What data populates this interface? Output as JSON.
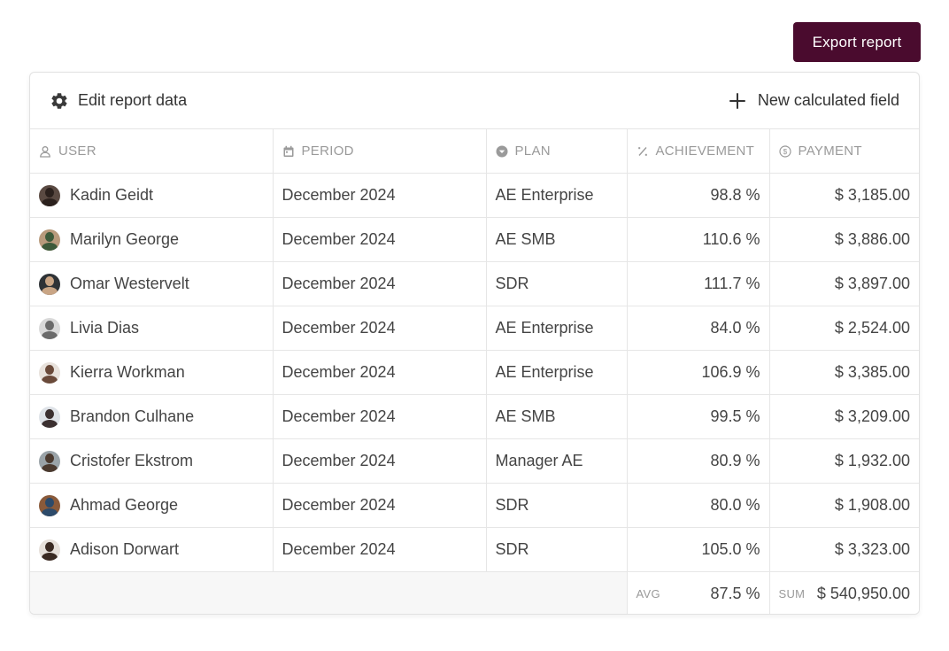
{
  "toolbar": {
    "export_label": "Export report",
    "edit_label": "Edit report data",
    "new_field_label": "New calculated field"
  },
  "columns": {
    "user": "USER",
    "period": "PERIOD",
    "plan": "PLAN",
    "achievement": "ACHIEVEMENT",
    "payment": "PAYMENT"
  },
  "rows": [
    {
      "name": "Kadin Geidt",
      "period": "December 2024",
      "plan": "AE Enterprise",
      "achievement": "98.8 %",
      "payment": "$ 3,185.00",
      "avatar_bg": "#5a4a42",
      "avatar_fg": "#2b211d"
    },
    {
      "name": "Marilyn George",
      "period": "December 2024",
      "plan": "AE SMB",
      "achievement": "110.6 %",
      "payment": "$ 3,886.00",
      "avatar_bg": "#b89a7c",
      "avatar_fg": "#3d5a3a"
    },
    {
      "name": "Omar Westervelt",
      "period": "December 2024",
      "plan": "SDR",
      "achievement": "111.7 %",
      "payment": "$ 3,897.00",
      "avatar_bg": "#2e3236",
      "avatar_fg": "#c9a585"
    },
    {
      "name": "Livia Dias",
      "period": "December 2024",
      "plan": "AE Enterprise",
      "achievement": "84.0 %",
      "payment": "$ 2,524.00",
      "avatar_bg": "#d9d9d9",
      "avatar_fg": "#6b6b6b"
    },
    {
      "name": "Kierra Workman",
      "period": "December 2024",
      "plan": "AE Enterprise",
      "achievement": "106.9 %",
      "payment": "$ 3,385.00",
      "avatar_bg": "#e8e2dc",
      "avatar_fg": "#6a4a3a"
    },
    {
      "name": "Brandon Culhane",
      "period": "December 2024",
      "plan": "AE SMB",
      "achievement": "99.5 %",
      "payment": "$ 3,209.00",
      "avatar_bg": "#dfe3e8",
      "avatar_fg": "#3b3030"
    },
    {
      "name": "Cristofer Ekstrom",
      "period": "December 2024",
      "plan": "Manager AE",
      "achievement": "80.9 %",
      "payment": "$ 1,932.00",
      "avatar_bg": "#9aa3a8",
      "avatar_fg": "#4b3a2f"
    },
    {
      "name": "Ahmad George",
      "period": "December 2024",
      "plan": "SDR",
      "achievement": "80.0 %",
      "payment": "$ 1,908.00",
      "avatar_bg": "#8a5a3a",
      "avatar_fg": "#2c4a6a"
    },
    {
      "name": "Adison Dorwart",
      "period": "December 2024",
      "plan": "SDR",
      "achievement": "105.0 %",
      "payment": "$ 3,323.00",
      "avatar_bg": "#e6e0da",
      "avatar_fg": "#3a2a22"
    }
  ],
  "footer": {
    "avg_label": "AVG",
    "avg_value": "87.5 %",
    "sum_label": "SUM",
    "sum_value": "$ 540,950.00"
  },
  "colors": {
    "accent": "#4a0b2e"
  }
}
